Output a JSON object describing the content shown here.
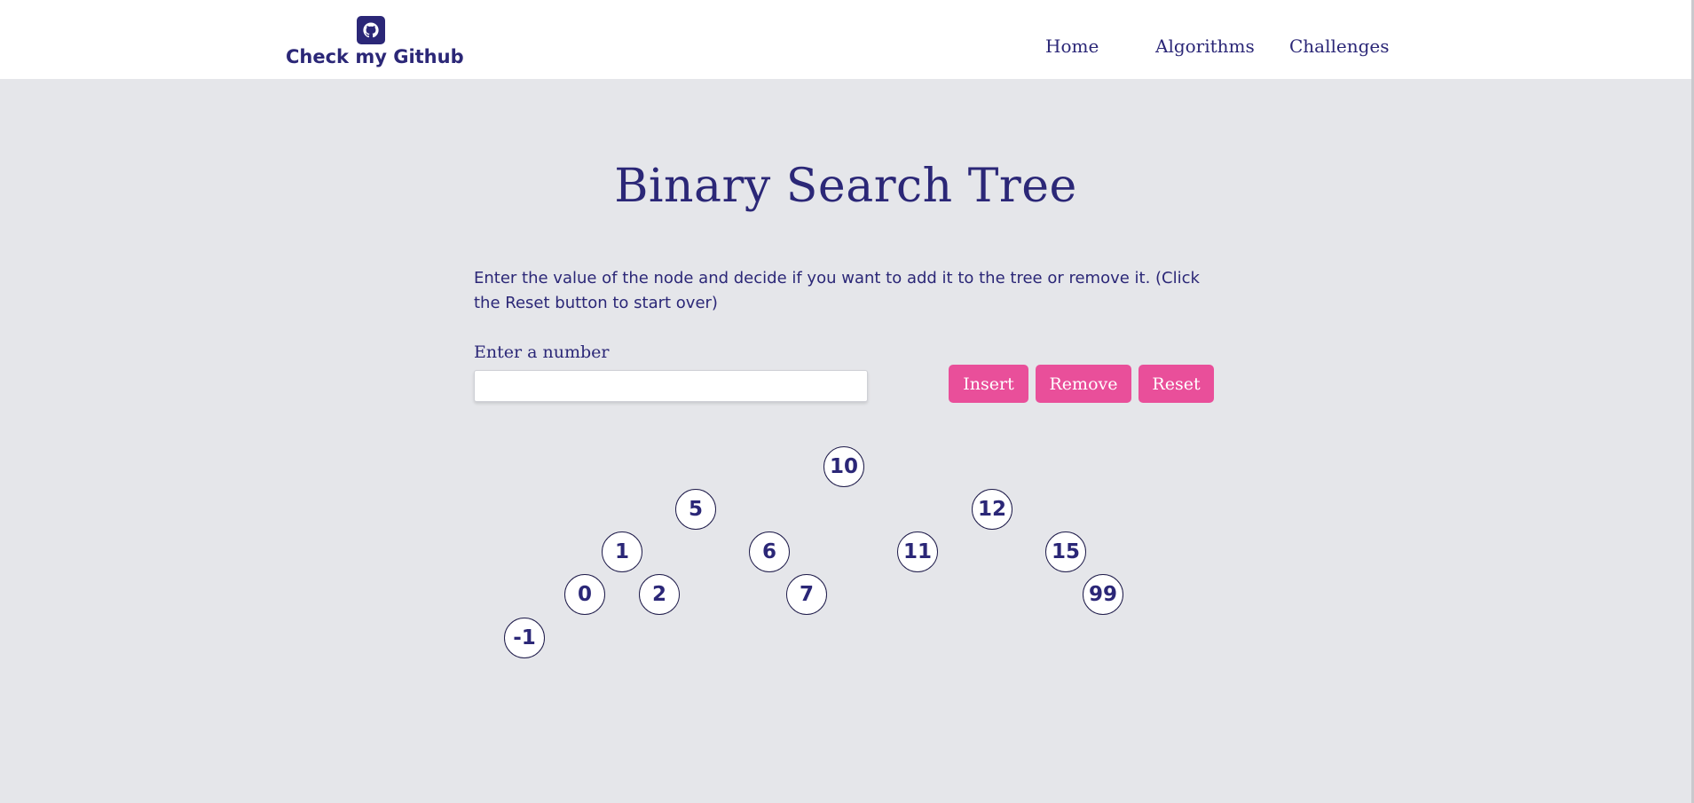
{
  "header": {
    "brand_text": "Check my Github",
    "brand_icon": "github-icon",
    "nav": {
      "home": "Home",
      "algorithms": "Algorithms",
      "challenges": "Challenges"
    }
  },
  "main": {
    "title": "Binary Search Tree",
    "description": "Enter the value of the node and decide if you want to add it to the tree or remove it. (Click the Reset button to start over)",
    "input_label": "Enter a number",
    "input_value": "",
    "buttons": {
      "insert": "Insert",
      "remove": "Remove",
      "reset": "Reset"
    }
  },
  "tree": {
    "nodes": [
      "10",
      "5",
      "12",
      "1",
      "6",
      "11",
      "15",
      "0",
      "2",
      "7",
      "99",
      "-1"
    ]
  },
  "colors": {
    "primary": "#2b2777",
    "accent": "#e94f9a",
    "background": "#e5e6ea",
    "header": "#ffffff"
  }
}
